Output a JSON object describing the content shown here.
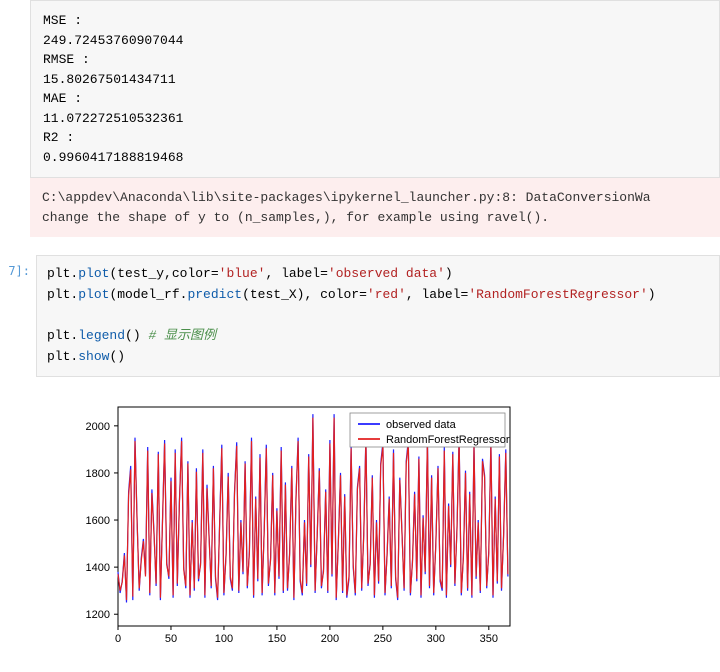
{
  "output": {
    "mse_label": "MSE :",
    "mse_value": "249.72453760907044",
    "rmse_label": "RMSE :",
    "rmse_value": "15.80267501434711",
    "mae_label": "MAE :",
    "mae_value": "11.072272510532361",
    "r2_label": "R2 :",
    "r2_value": "0.9960417188819468"
  },
  "warning": {
    "line1": "C:\\appdev\\Anaconda\\lib\\site-packages\\ipykernel_launcher.py:8: DataConversionWa",
    "line2": "change the shape of y to (n_samples,), for example using ravel()."
  },
  "prompt": "7]:",
  "code": {
    "l1a": "plt.",
    "l1b": "plot",
    "l1c": "(test_y,color=",
    "l1d": "'blue'",
    "l1e": ", label=",
    "l1f": "'observed data'",
    "l1g": ")",
    "l2a": "plt.",
    "l2b": "plot",
    "l2c": "(model_rf.",
    "l2d": "predict",
    "l2e": "(test_X), color=",
    "l2f": "'red'",
    "l2g": ", label=",
    "l2h": "'RandomForestRegressor'",
    "l2i": ")",
    "l3a": "plt.",
    "l3b": "legend",
    "l3c": "() ",
    "l3d": "# 显示图例",
    "l4a": "plt.",
    "l4b": "show",
    "l4c": "()"
  },
  "chart_data": {
    "type": "line",
    "title": "",
    "xlabel": "",
    "ylabel": "",
    "xlim": [
      0,
      370
    ],
    "ylim": [
      1150,
      2080
    ],
    "xticks": [
      0,
      50,
      100,
      150,
      200,
      250,
      300,
      350
    ],
    "yticks": [
      1200,
      1400,
      1600,
      1800,
      2000
    ],
    "legend_position": "upper right",
    "series": [
      {
        "name": "observed data",
        "color": "#1f1fff"
      },
      {
        "name": "RandomForestRegressor",
        "color": "#e22020"
      }
    ],
    "x": [
      0,
      2,
      4,
      6,
      8,
      10,
      12,
      14,
      16,
      18,
      20,
      22,
      24,
      26,
      28,
      30,
      32,
      34,
      36,
      38,
      40,
      42,
      44,
      46,
      48,
      50,
      52,
      54,
      56,
      58,
      60,
      62,
      64,
      66,
      68,
      70,
      72,
      74,
      76,
      78,
      80,
      82,
      84,
      86,
      88,
      90,
      92,
      94,
      96,
      98,
      100,
      102,
      104,
      106,
      108,
      110,
      112,
      114,
      116,
      118,
      120,
      122,
      124,
      126,
      128,
      130,
      132,
      134,
      136,
      138,
      140,
      142,
      144,
      146,
      148,
      150,
      152,
      154,
      156,
      158,
      160,
      162,
      164,
      166,
      168,
      170,
      172,
      174,
      176,
      178,
      180,
      182,
      184,
      186,
      188,
      190,
      192,
      194,
      196,
      198,
      200,
      202,
      204,
      206,
      208,
      210,
      212,
      214,
      216,
      218,
      220,
      222,
      224,
      226,
      228,
      230,
      232,
      234,
      236,
      238,
      240,
      242,
      244,
      246,
      248,
      250,
      252,
      254,
      256,
      258,
      260,
      262,
      264,
      266,
      268,
      270,
      272,
      274,
      276,
      278,
      280,
      282,
      284,
      286,
      288,
      290,
      292,
      294,
      296,
      298,
      300,
      302,
      304,
      306,
      308,
      310,
      312,
      314,
      316,
      318,
      320,
      322,
      324,
      326,
      328,
      330,
      332,
      334,
      336,
      338,
      340,
      342,
      344,
      346,
      348,
      350,
      352,
      354,
      356,
      358,
      360,
      362,
      364,
      366,
      368
    ],
    "observed": [
      1380,
      1290,
      1340,
      1460,
      1250,
      1720,
      1830,
      1260,
      1950,
      1600,
      1300,
      1440,
      1520,
      1370,
      1910,
      1280,
      1730,
      1550,
      1320,
      1890,
      1260,
      1600,
      1940,
      1420,
      1350,
      1780,
      1270,
      1900,
      1320,
      1680,
      1950,
      1400,
      1310,
      1850,
      1270,
      1600,
      1300,
      1820,
      1340,
      1420,
      1900,
      1270,
      1750,
      1530,
      1310,
      1830,
      1350,
      1260,
      1600,
      1920,
      1280,
      1460,
      1800,
      1350,
      1300,
      1720,
      1930,
      1290,
      1600,
      1370,
      1850,
      1310,
      1470,
      1950,
      1270,
      1700,
      1340,
      1880,
      1280,
      1560,
      1920,
      1320,
      1440,
      1800,
      1280,
      1650,
      1350,
      1910,
      1290,
      1760,
      1300,
      1460,
      1830,
      1260,
      1700,
      1950,
      1340,
      1280,
      1600,
      1320,
      1880,
      1400,
      2050,
      1290,
      1540,
      1820,
      1310,
      1390,
      1730,
      1290,
      1940,
      1360,
      2050,
      1260,
      1520,
      1800,
      1290,
      1710,
      1270,
      1350,
      1920,
      1400,
      1280,
      1740,
      1830,
      1300,
      1550,
      1960,
      1320,
      1420,
      1790,
      1270,
      1600,
      1330,
      1840,
      1930,
      1280,
      1460,
      1700,
      1310,
      1900,
      1350,
      1260,
      1780,
      1560,
      1300,
      1850,
      1940,
      1280,
      1430,
      1720,
      1340,
      1870,
      1270,
      1620,
      1370,
      1950,
      1310,
      1790,
      1280,
      1500,
      1830,
      1340,
      1300,
      1910,
      1270,
      1670,
      1400,
      1890,
      1320,
      1570,
      1960,
      1280,
      1450,
      1810,
      1300,
      1720,
      1270,
      1930,
      1350,
      1600,
      1290,
      1860,
      1790,
      1310,
      1470,
      1940,
      1270,
      1700,
      1330,
      1880,
      1300,
      1540,
      1900,
      1360
    ],
    "predicted": [
      1370,
      1300,
      1335,
      1450,
      1260,
      1705,
      1815,
      1275,
      1935,
      1590,
      1310,
      1430,
      1510,
      1360,
      1895,
      1290,
      1715,
      1540,
      1330,
      1880,
      1270,
      1590,
      1925,
      1410,
      1360,
      1765,
      1280,
      1885,
      1330,
      1670,
      1935,
      1390,
      1320,
      1840,
      1280,
      1590,
      1310,
      1805,
      1350,
      1410,
      1885,
      1280,
      1735,
      1520,
      1320,
      1820,
      1360,
      1270,
      1590,
      1905,
      1290,
      1450,
      1785,
      1360,
      1310,
      1710,
      1915,
      1300,
      1590,
      1380,
      1840,
      1320,
      1460,
      1935,
      1280,
      1690,
      1350,
      1865,
      1290,
      1550,
      1905,
      1330,
      1430,
      1790,
      1290,
      1640,
      1360,
      1895,
      1300,
      1750,
      1310,
      1450,
      1820,
      1270,
      1690,
      1935,
      1350,
      1290,
      1590,
      1330,
      1870,
      1410,
      2035,
      1300,
      1530,
      1810,
      1320,
      1380,
      1720,
      1300,
      1925,
      1370,
      2035,
      1270,
      1510,
      1790,
      1300,
      1700,
      1280,
      1360,
      1905,
      1410,
      1290,
      1730,
      1820,
      1310,
      1540,
      1945,
      1330,
      1410,
      1780,
      1280,
      1590,
      1340,
      1830,
      1915,
      1290,
      1450,
      1690,
      1320,
      1885,
      1360,
      1270,
      1770,
      1550,
      1310,
      1840,
      1925,
      1290,
      1420,
      1710,
      1350,
      1860,
      1280,
      1610,
      1380,
      1935,
      1320,
      1780,
      1290,
      1490,
      1820,
      1350,
      1310,
      1895,
      1280,
      1660,
      1410,
      1880,
      1330,
      1560,
      1945,
      1290,
      1440,
      1800,
      1310,
      1710,
      1280,
      1915,
      1360,
      1590,
      1300,
      1850,
      1780,
      1320,
      1460,
      1925,
      1280,
      1690,
      1340,
      1870,
      1310,
      1530,
      1885,
      1370
    ]
  }
}
